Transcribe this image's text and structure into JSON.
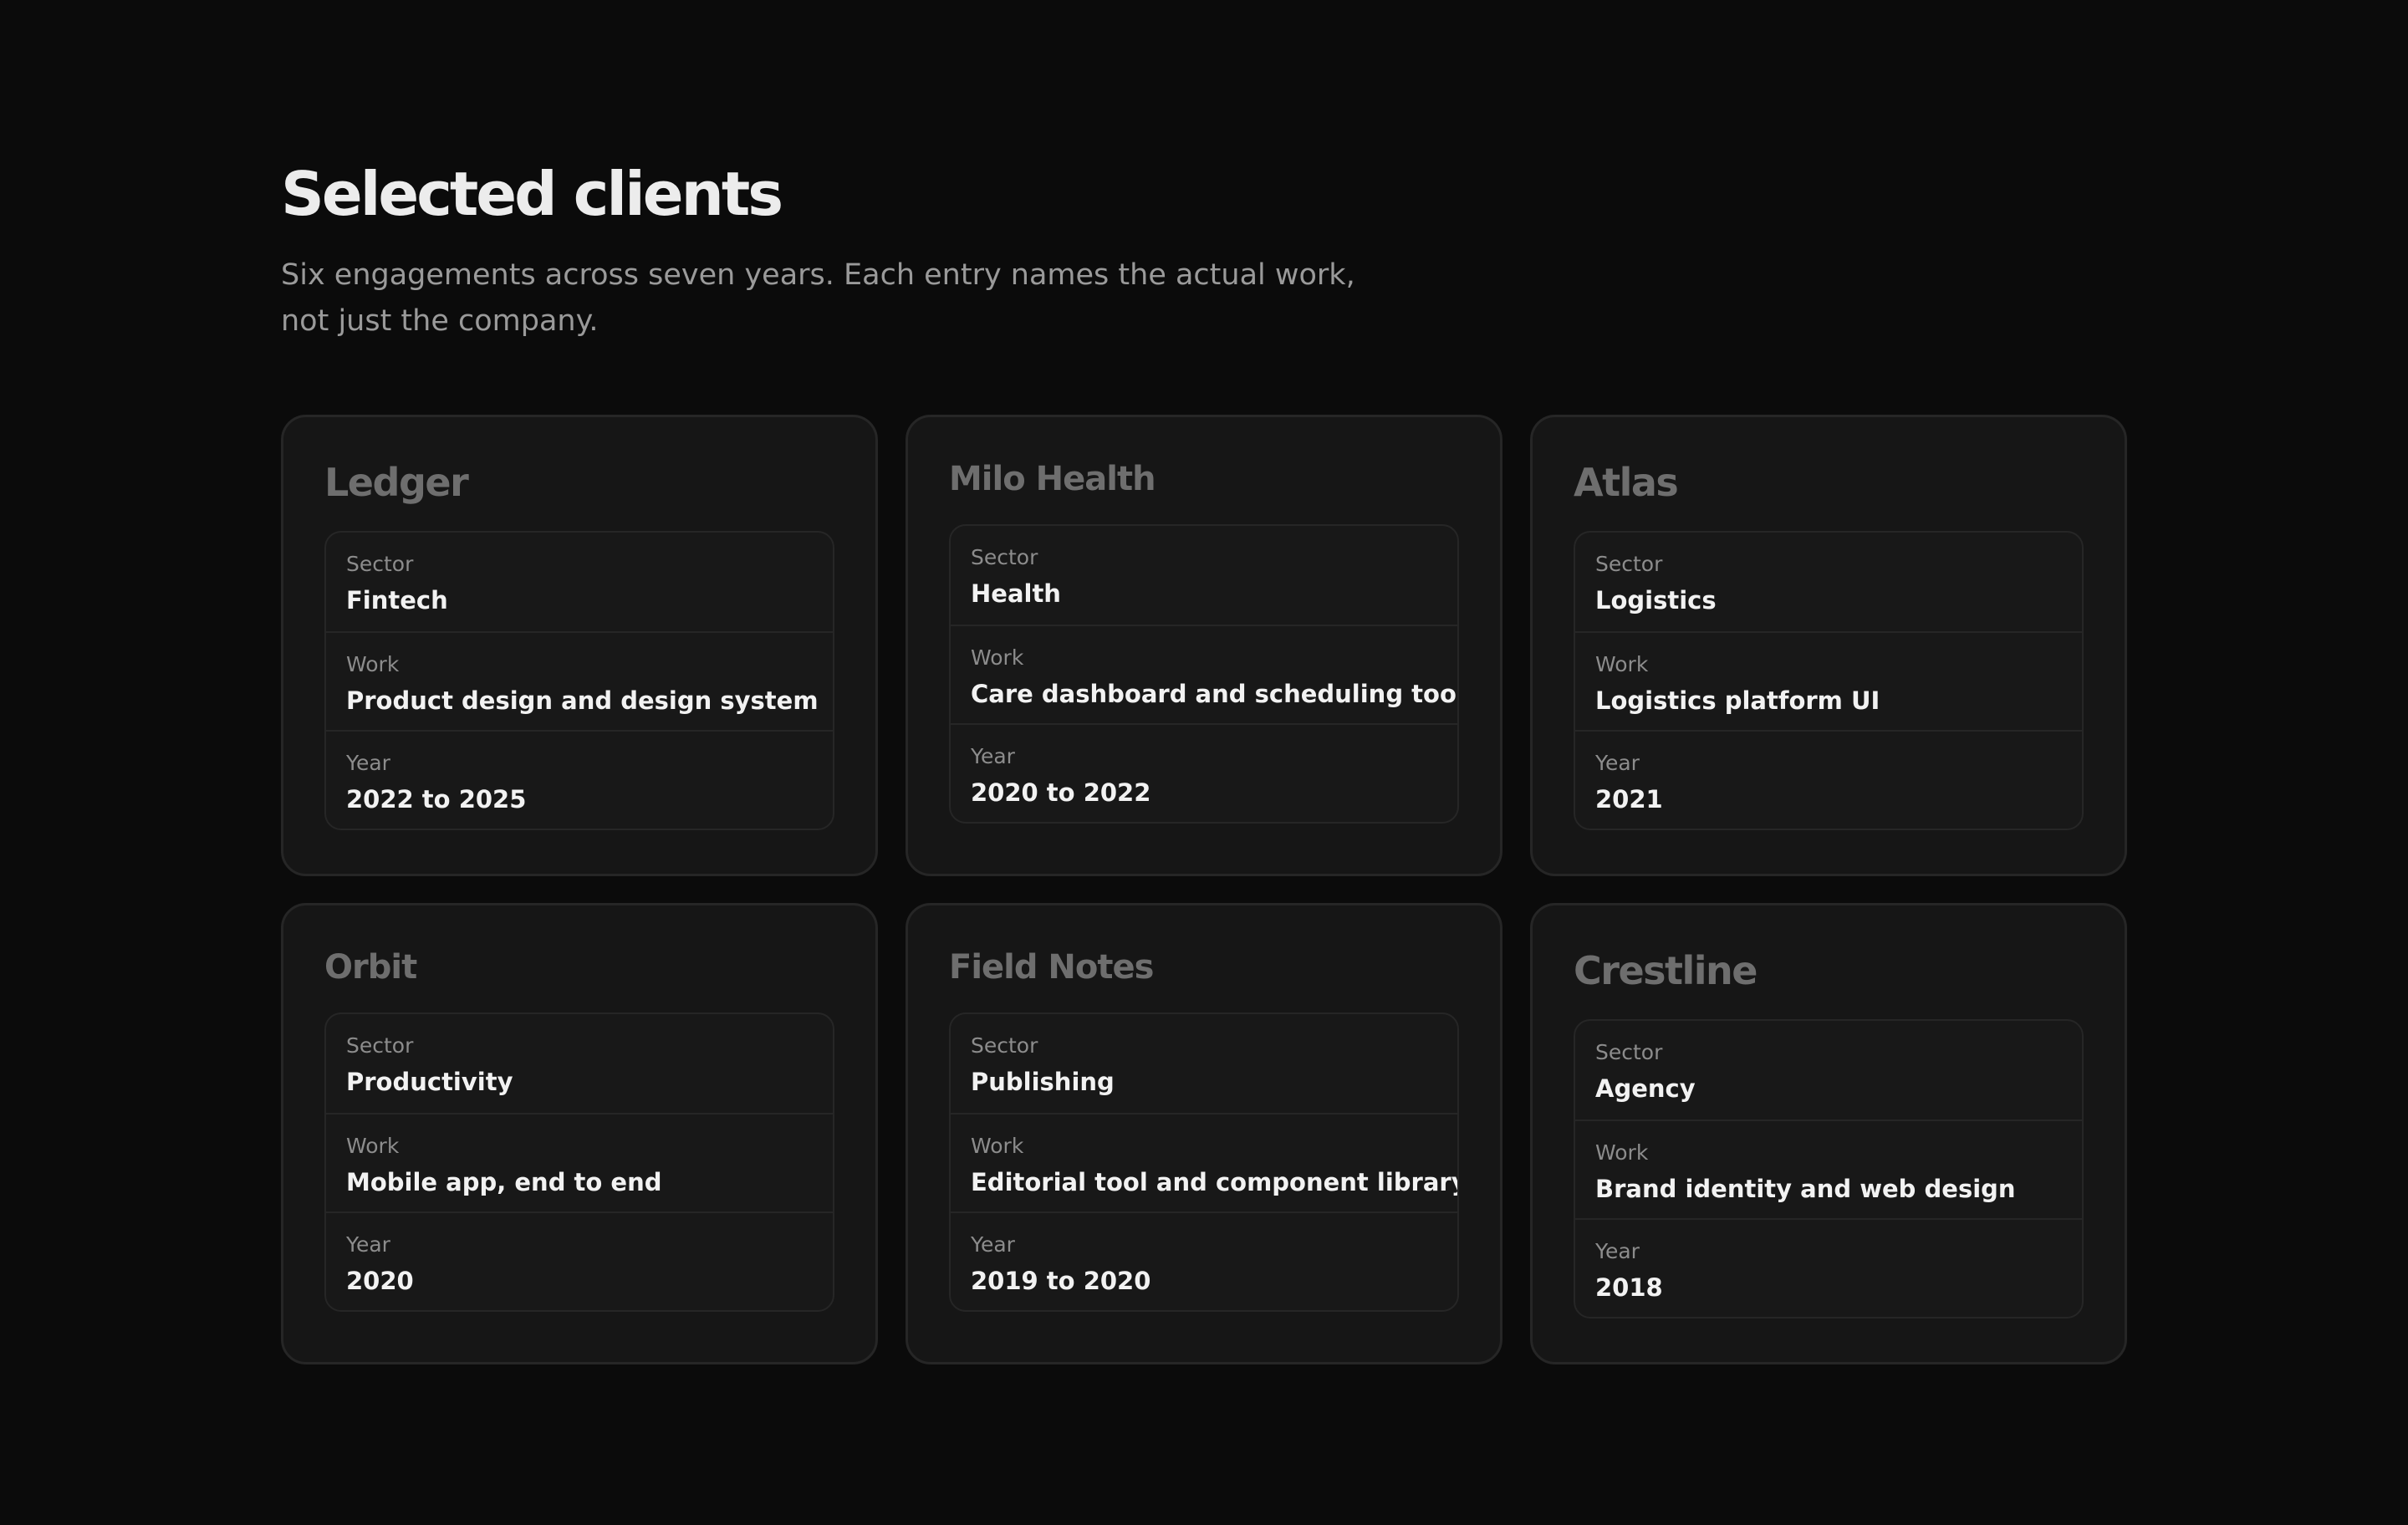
{
  "header": {
    "title": "Selected clients",
    "subtitle": "Six engagements across seven years. Each entry names the actual work, not just the company."
  },
  "clients": [
    {
      "name": "Ledger",
      "sector_label": "Sector",
      "sector": "Fintech",
      "work_label": "Work",
      "work": "Product design and design system",
      "year_label": "Year",
      "year": "2022 to 2025"
    },
    {
      "name": "Milo Health",
      "sector_label": "Sector",
      "sector": "Health",
      "work_label": "Work",
      "work": "Care dashboard and scheduling tool",
      "year_label": "Year",
      "year": "2020 to 2022"
    },
    {
      "name": "Atlas",
      "sector_label": "Sector",
      "sector": "Logistics",
      "work_label": "Work",
      "work": "Logistics platform UI",
      "year_label": "Year",
      "year": "2021"
    },
    {
      "name": "Orbit",
      "sector_label": "Sector",
      "sector": "Productivity",
      "work_label": "Work",
      "work": "Mobile app, end to end",
      "year_label": "Year",
      "year": "2020"
    },
    {
      "name": "Field Notes",
      "sector_label": "Sector",
      "sector": "Publishing",
      "work_label": "Work",
      "work": "Editorial tool and component library",
      "year_label": "Year",
      "year": "2019 to 2020"
    },
    {
      "name": "Crestline",
      "sector_label": "Sector",
      "sector": "Agency",
      "work_label": "Work",
      "work": "Brand identity and web design",
      "year_label": "Year",
      "year": "2018"
    }
  ]
}
